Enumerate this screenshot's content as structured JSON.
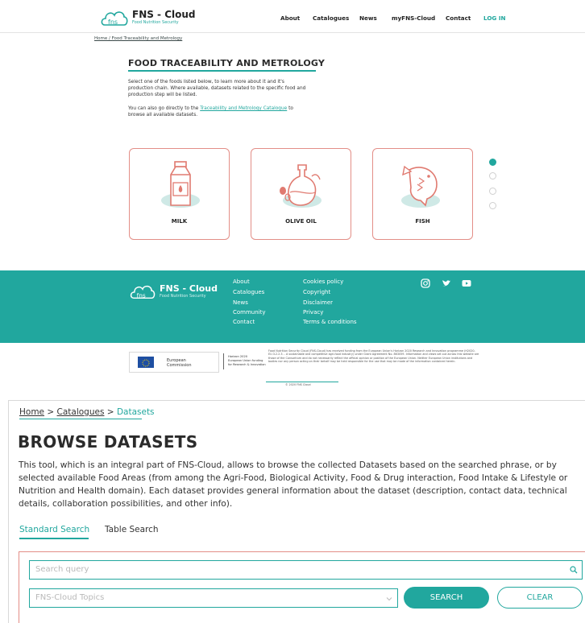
{
  "brand": {
    "name": "FNS - Cloud",
    "tagline": "Food Nutrition Security"
  },
  "nav": {
    "items": [
      "About",
      "Catalogues",
      "News",
      "myFNS-Cloud",
      "Contact",
      "LOG IN"
    ]
  },
  "food_page": {
    "breadcrumb": "Home / Food Traceability and Metrology",
    "title": "FOOD TRACEABILITY AND METROLOGY",
    "intro_line1": "Select one of the foods listed below, to learn more about it and it's",
    "intro_line2": "production chain. Where available, datasets related to the specific food and",
    "intro_line3": "production step will be listed.",
    "catalogue_prefix": "You can also go directly to the",
    "catalogue_link": "Traceability and Metrology Catalogue",
    "catalogue_suffix": "to",
    "catalogue_line2": "browse all available datasets.",
    "cards": [
      {
        "label": "MILK",
        "icon": "milk-carton-icon"
      },
      {
        "label": "OLIVE OIL",
        "icon": "olive-oil-bottle-icon"
      },
      {
        "label": "FISH",
        "icon": "fish-icon"
      }
    ],
    "carousel": {
      "pages": 4,
      "active": 1
    }
  },
  "footer": {
    "col1": [
      "About",
      "Catalogues",
      "News",
      "Community",
      "Contact"
    ],
    "col2": [
      "Cookies policy",
      "Copyright",
      "Disclaimer",
      "Privacy",
      "Terms & conditions"
    ],
    "social": [
      "instagram-icon",
      "twitter-icon",
      "youtube-icon"
    ],
    "eu_line1": "European",
    "eu_line2": "Commission",
    "h2020_line1": "Horizon 2020",
    "h2020_line2": "European Union funding",
    "h2020_line3": "for Research & Innovation",
    "legal": "Food Nutrition Security Cloud (FNS-Cloud) has received funding from the European Union's Horizon 2020 Research and Innovation programme (H2020-EU.3.2.2.3. - A sustainable and competitive agri-food industry) under Grant Agreement No. 863059. Information and views set out across this website are those of the Consortium and do not necessarily reflect the official opinion or position of the European Union. Neither European Union institutions and bodies nor any person acting on their behalf may be held responsible for the use that may be made of the information contained herein.",
    "copyright": "© 2020 FNS Cloud"
  },
  "browse": {
    "breadcrumb": {
      "home": "Home",
      "sep": ">",
      "catalogues": "Catalogues",
      "current": "Datasets"
    },
    "title": "BROWSE DATASETS",
    "description": "This tool, which is an integral part of FNS-Cloud, allows to browse the collected Datasets based on the searched phrase, or by selected available Food Areas (from among the Agri-Food, Biological Activity, Food & Drug interaction, Food Intake & Lifestyle or Nutrition and Health domain). Each dataset provides general information about the dataset (description, contact data, technical details, collaboration possibilities, and other info).",
    "tabs": [
      "Standard Search",
      "Table Search"
    ],
    "search_placeholder": "Search query",
    "topics_placeholder": "FNS-Cloud Topics",
    "search_button": "SEARCH",
    "clear_button": "CLEAR"
  },
  "colors": {
    "accent": "#21a79e",
    "card_border": "#e38e87",
    "text": "#2b2b2b"
  }
}
